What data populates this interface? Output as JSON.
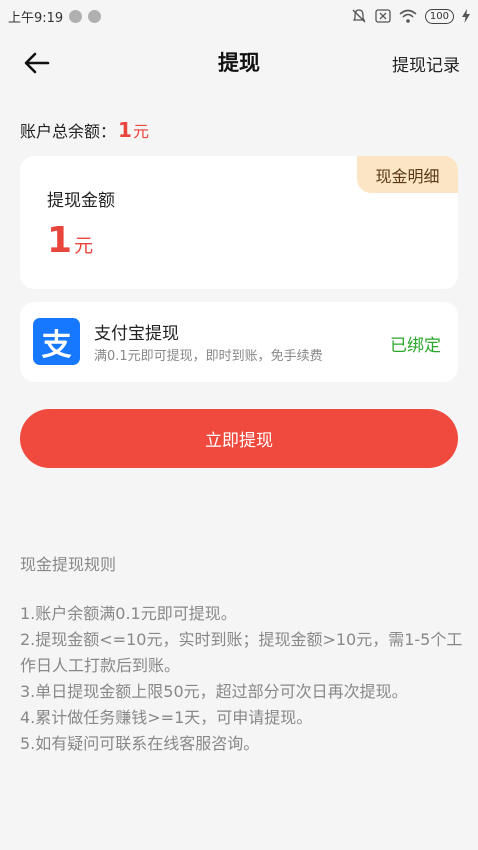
{
  "status_bar": {
    "time": "上午9:19",
    "battery": "100"
  },
  "header": {
    "title": "提现",
    "record_link": "提现记录"
  },
  "balance": {
    "label": "账户总余额：",
    "amount": "1",
    "unit": "元"
  },
  "amount_card": {
    "detail_tag": "现金明细",
    "label": "提现金额",
    "amount": "1",
    "unit": "元"
  },
  "alipay": {
    "logo_char": "支",
    "title": "支付宝提现",
    "subtitle": "满0.1元即可提现，即时到账，免手续费",
    "status": "已绑定"
  },
  "withdraw_button": "立即提现",
  "rules": {
    "title": "现金提现规则",
    "items": [
      "1.账户余额满0.1元即可提现。",
      "2.提现金额<=10元，实时到账；提现金额>10元，需1-5个工作日人工打款后到账。",
      "3.单日提现金额上限50元，超过部分可次日再次提现。",
      "4.累计做任务赚钱>=1天，可申请提现。",
      "5.如有疑问可联系在线客服咨询。"
    ]
  },
  "colors": {
    "accent_red": "#f04a3e",
    "bound_green": "#2aa72a",
    "alipay_blue": "#1677ff",
    "tag_bg": "#fbe5c4"
  }
}
